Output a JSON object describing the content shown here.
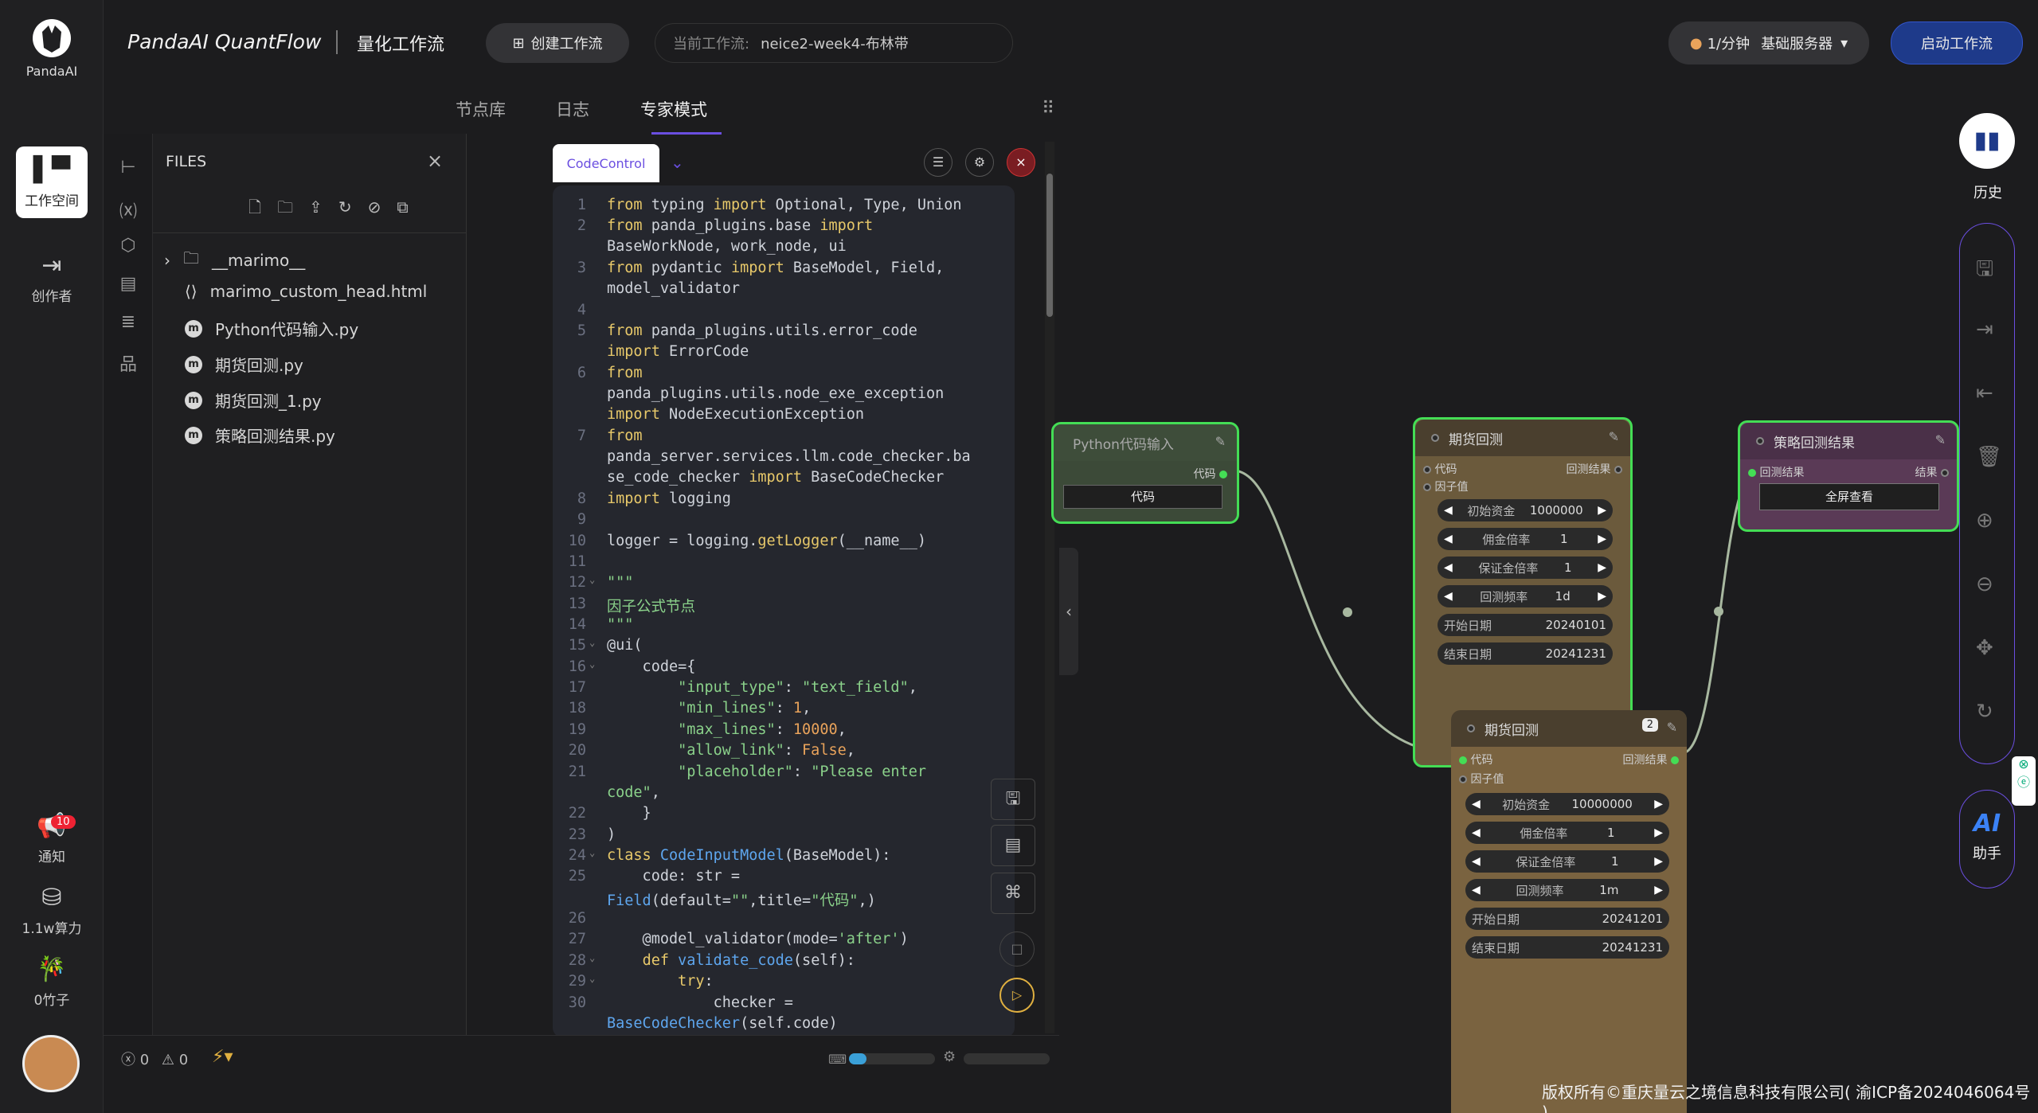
{
  "brand": {
    "logo_text": "PandaAI",
    "app_title": "PandaAI QuantFlow",
    "subtitle": "量化工作流"
  },
  "topbar": {
    "create_label": "创建工作流",
    "current_prefix": "当前工作流:",
    "current_name": "neice2-week4-布林带",
    "server_rate": "1/分钟",
    "server_name": "基础服务器",
    "start_label": "启动工作流"
  },
  "rail": {
    "workspace": "工作空间",
    "creator": "创作者",
    "notify": "通知",
    "notify_count": "10",
    "compute": "1.1w算力",
    "bamboo": "0竹子"
  },
  "tabs": [
    "节点库",
    "日志",
    "专家模式"
  ],
  "files": {
    "title": "FILES",
    "items": [
      "__marimo__",
      "marimo_custom_head.html",
      "Python代码输入.py",
      "期货回测.py",
      "期货回测_1.py",
      "策略回测结果.py"
    ]
  },
  "editor": {
    "control_label": "CodeControl"
  },
  "status": {
    "errors": "0",
    "warnings": "0"
  },
  "right_panel": {
    "history": "历史",
    "assistant_title": "AI",
    "assistant": "助手"
  },
  "nodes": {
    "python_input": {
      "title": "Python代码输入",
      "out": "代码",
      "button": "代码"
    },
    "backtest1": {
      "title": "期货回测",
      "in1": "代码",
      "in2": "因子值",
      "out": "回测结果",
      "fields": [
        {
          "label": "初始资金",
          "value": "1000000"
        },
        {
          "label": "佣金倍率",
          "value": "1"
        },
        {
          "label": "保证金倍率",
          "value": "1"
        },
        {
          "label": "回测频率",
          "value": "1d"
        },
        {
          "label": "开始日期",
          "value": "20240101"
        },
        {
          "label": "结束日期",
          "value": "20241231"
        }
      ]
    },
    "result": {
      "title": "策略回测结果",
      "in": "回测结果",
      "out": "结果",
      "button": "全屏查看"
    },
    "backtest2": {
      "title": "期货回测",
      "badge": "2",
      "in1": "代码",
      "in2": "因子值",
      "out": "回测结果",
      "fields": [
        {
          "label": "初始资金",
          "value": "10000000"
        },
        {
          "label": "佣金倍率",
          "value": "1"
        },
        {
          "label": "保证金倍率",
          "value": "1"
        },
        {
          "label": "回测频率",
          "value": "1m"
        },
        {
          "label": "开始日期",
          "value": "20241201"
        },
        {
          "label": "结束日期",
          "value": "20241231"
        }
      ]
    }
  },
  "footer": "版权所有©重庆量云之境信息科技有限公司( 渝ICP备2024046064号 )"
}
